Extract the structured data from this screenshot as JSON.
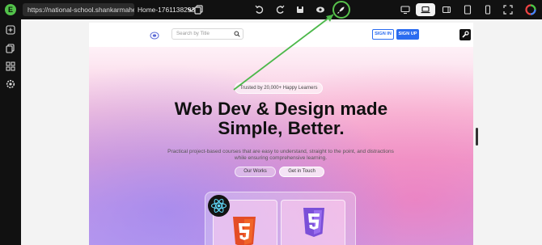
{
  "app": {
    "logo_letter": "E",
    "url": "https://national-school.shankarmahesh.com/",
    "page_name": "Home-1761138293"
  },
  "toolbar": {
    "icons": [
      "chevron-down-icon",
      "copy-icon",
      "undo-icon",
      "redo-icon",
      "save-icon",
      "preview-eye-icon",
      "publish-rocket-icon"
    ],
    "devices": [
      "desktop-icon",
      "laptop-icon",
      "tablet-landscape-icon",
      "tablet-portrait-icon",
      "mobile-icon",
      "fullscreen-icon",
      "color-wheel-icon"
    ],
    "active_device": "laptop-icon",
    "highlight_color": "#58c24c"
  },
  "sidebar": {
    "icons": [
      "add-icon",
      "pages-icon",
      "components-icon",
      "settings-gear-icon"
    ]
  },
  "site": {
    "search_placeholder": "Search by Title",
    "signin_label": "SIGN IN",
    "signup_label": "SIGN UP",
    "badge_text": "Trusted by 20,000+ Happy Learners",
    "hero_line1": "Web Dev & Design made",
    "hero_line2": "Simple, Better.",
    "hero_sub_line1": "Practical project-based courses that are easy to understand, straight to the point, and distractions",
    "hero_sub_line2": "while ensuring comprehensive learning.",
    "btn_works": "Our Works",
    "btn_touch": "Get in Touch",
    "brand_color": "#2b6cf0"
  }
}
